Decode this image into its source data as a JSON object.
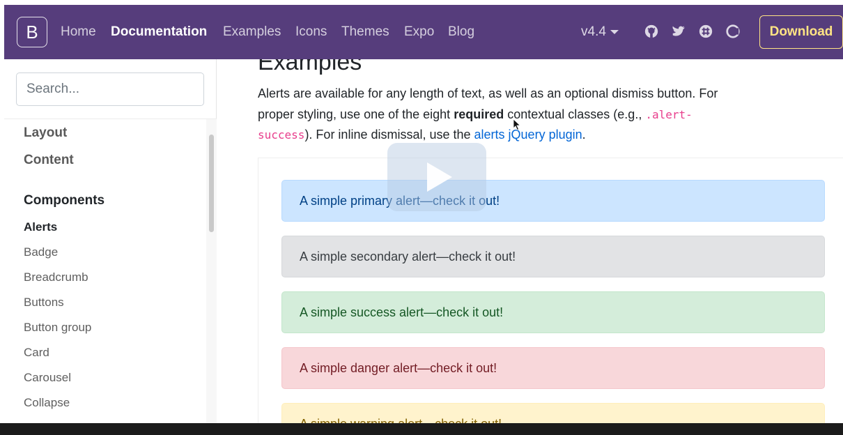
{
  "navbar": {
    "brand": "B",
    "links": [
      {
        "label": "Home",
        "active": false
      },
      {
        "label": "Documentation",
        "active": true
      },
      {
        "label": "Examples",
        "active": false
      },
      {
        "label": "Icons",
        "active": false
      },
      {
        "label": "Themes",
        "active": false
      },
      {
        "label": "Expo",
        "active": false
      },
      {
        "label": "Blog",
        "active": false
      }
    ],
    "version": "v4.4",
    "icons": [
      "github-icon",
      "twitter-icon",
      "slack-icon",
      "opencollective-icon"
    ],
    "download_label": "Download",
    "background_color": "#563d7c",
    "download_color": "#ffe484"
  },
  "sidebar": {
    "search_placeholder": "Search...",
    "groups": [
      "Layout",
      "Content"
    ],
    "section_heading": "Components",
    "items": [
      {
        "label": "Alerts",
        "active": true
      },
      {
        "label": "Badge",
        "active": false
      },
      {
        "label": "Breadcrumb",
        "active": false
      },
      {
        "label": "Buttons",
        "active": false
      },
      {
        "label": "Button group",
        "active": false
      },
      {
        "label": "Card",
        "active": false
      },
      {
        "label": "Carousel",
        "active": false
      },
      {
        "label": "Collapse",
        "active": false
      }
    ]
  },
  "main": {
    "title": "Examples",
    "intro": {
      "part1": "Alerts are available for any length of text, as well as an optional dismiss button. For proper styling, use one of the eight ",
      "bold": "required",
      "part2": " contextual classes (e.g., ",
      "code": ".alert-success",
      "part3": "). For inline dismissal, use the ",
      "link": "alerts jQuery plugin",
      "part4": "."
    },
    "alerts": [
      {
        "variant": "primary",
        "text": "A simple primary alert—check it out!"
      },
      {
        "variant": "secondary",
        "text": "A simple secondary alert—check it out!"
      },
      {
        "variant": "success",
        "text": "A simple success alert—check it out!"
      },
      {
        "variant": "danger",
        "text": "A simple danger alert—check it out!"
      },
      {
        "variant": "warning",
        "text": "A simple warning alert—check it out!"
      }
    ]
  },
  "overlay": {
    "icon": "play-icon"
  }
}
